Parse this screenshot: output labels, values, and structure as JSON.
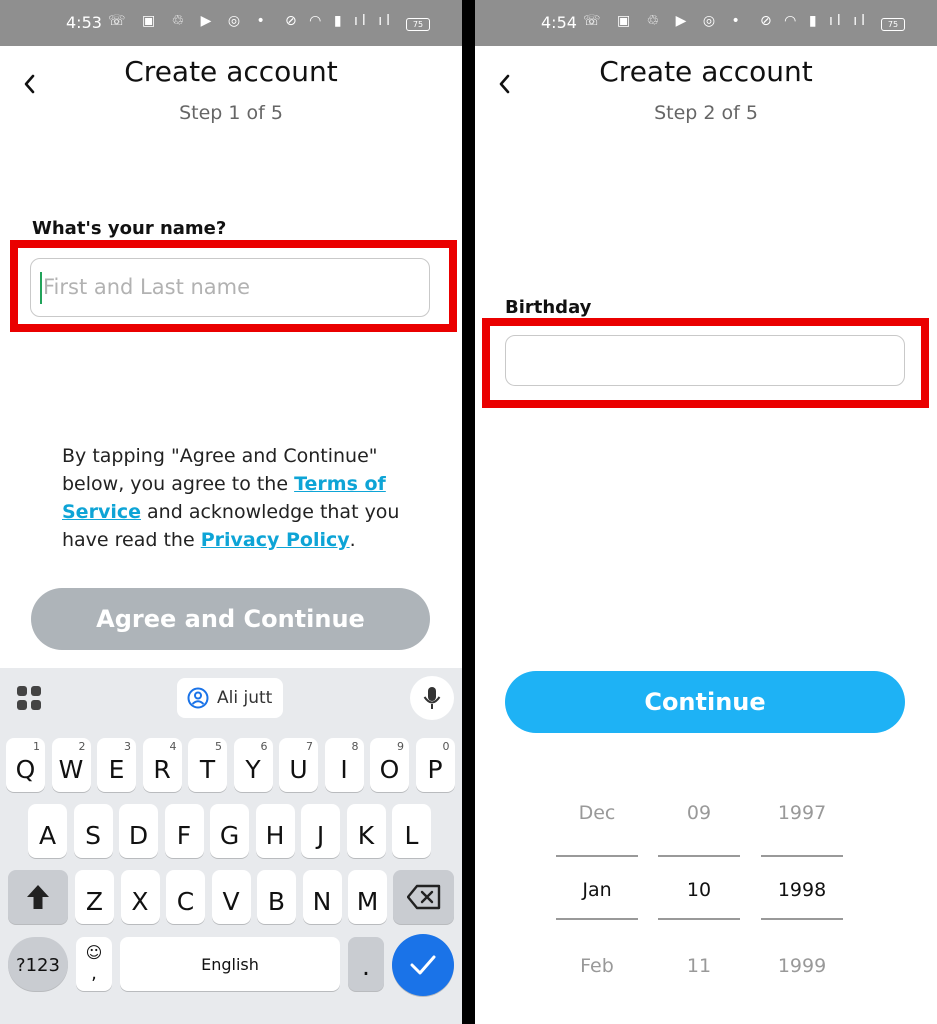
{
  "left": {
    "status": {
      "time": "4:53",
      "battery": "75"
    },
    "title": "Create account",
    "step": "Step 1 of 5",
    "name_label": "What's your name?",
    "name_placeholder": "First and Last name",
    "terms_pre": "By tapping \"Agree and Continue\" below, you agree to the ",
    "terms_link": "Terms of Service",
    "terms_mid": " and acknowledge that you have read the ",
    "privacy_link": "Privacy Policy",
    "terms_end": ".",
    "agree_button": "Agree and Continue",
    "keyboard": {
      "suggestion": "Ali jutt",
      "row1": [
        [
          "Q",
          "1"
        ],
        [
          "W",
          "2"
        ],
        [
          "E",
          "3"
        ],
        [
          "R",
          "4"
        ],
        [
          "T",
          "5"
        ],
        [
          "Y",
          "6"
        ],
        [
          "U",
          "7"
        ],
        [
          "I",
          "8"
        ],
        [
          "O",
          "9"
        ],
        [
          "P",
          "0"
        ]
      ],
      "row2": [
        "A",
        "S",
        "D",
        "F",
        "G",
        "H",
        "J",
        "K",
        "L"
      ],
      "row3": [
        "Z",
        "X",
        "C",
        "V",
        "B",
        "N",
        "M"
      ],
      "symbols": "?123",
      "space": "English",
      "period": ".",
      "emoji_sub": ","
    }
  },
  "right": {
    "status": {
      "time": "4:54",
      "battery": "75"
    },
    "title": "Create account",
    "step": "Step 2 of 5",
    "birthday_label": "Birthday",
    "continue_button": "Continue",
    "picker": {
      "months": [
        "Dec",
        "Jan",
        "Feb"
      ],
      "days": [
        "09",
        "10",
        "11"
      ],
      "years": [
        "1997",
        "1998",
        "1999"
      ]
    }
  },
  "colors": {
    "accent": "#1eb2f5",
    "disabled": "#aeb4b9",
    "highlight": "#ea0000",
    "link": "#0ea4d6"
  }
}
